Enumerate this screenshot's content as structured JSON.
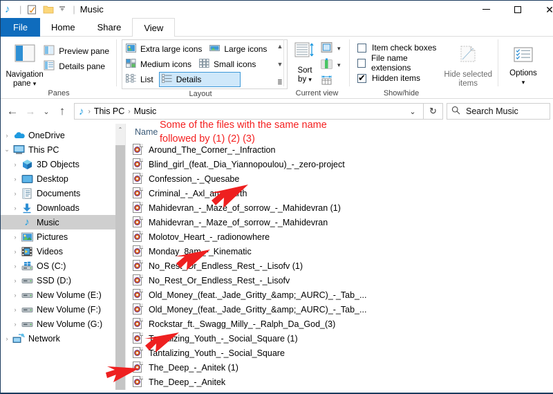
{
  "titlebar": {
    "qat_icons": [
      "music-note-icon",
      "properties-icon",
      "new-folder-icon",
      "customize-quick-access-chevron-icon"
    ],
    "title": "Music",
    "minimize_label": "—",
    "maximize_label": "□",
    "close_label": "✕"
  },
  "tabs": [
    {
      "label": "File",
      "active": false,
      "style": "file"
    },
    {
      "label": "Home",
      "active": false
    },
    {
      "label": "Share",
      "active": false
    },
    {
      "label": "View",
      "active": true
    }
  ],
  "ribbon": {
    "panes": {
      "group_label": "Panes",
      "navigation_pane": "Navigation\npane",
      "navigation_pane_line1": "Navigation",
      "navigation_pane_line2": "pane",
      "preview_pane": "Preview pane",
      "details_pane": "Details pane"
    },
    "layout": {
      "group_label": "Layout",
      "items": [
        {
          "label": "Extra large icons",
          "selected": false
        },
        {
          "label": "Large icons",
          "selected": false
        },
        {
          "label": "Medium icons",
          "selected": false
        },
        {
          "label": "Small icons",
          "selected": false
        },
        {
          "label": "List",
          "selected": false
        },
        {
          "label": "Details",
          "selected": true
        }
      ],
      "scroll_up": "▲",
      "scroll_down": "▼",
      "expand": "≣"
    },
    "current_view": {
      "group_label": "Current view",
      "sort_by_line1": "Sort",
      "sort_by_line2": "by",
      "group_by_icon": "group-by-icon",
      "add_columns_icon": "add-columns-icon",
      "size_columns_icon": "size-all-columns-to-fit-icon"
    },
    "show_hide": {
      "group_label": "Show/hide",
      "checkboxes": [
        {
          "label": "Item check boxes",
          "checked": false
        },
        {
          "label": "File name extensions",
          "checked": false
        },
        {
          "label": "Hidden items",
          "checked": true
        }
      ],
      "hide_selected_line1": "Hide selected",
      "hide_selected_line2": "items"
    },
    "options": {
      "label": "Options",
      "caret": "▾"
    }
  },
  "addressbar": {
    "back": "←",
    "forward": "→",
    "recent": "⌄",
    "up": "↑",
    "path_icon": "music-note-icon",
    "crumbs": [
      "This PC",
      "Music"
    ],
    "separator": "›",
    "dropdown": "⌄",
    "refresh": "↻",
    "search_placeholder": "Search Music"
  },
  "navpane": {
    "items": [
      {
        "label": "OneDrive",
        "icon": "onedrive-cloud-icon",
        "indent": 0,
        "chevron": "›",
        "selected": false
      },
      {
        "label": "This PC",
        "icon": "this-pc-monitor-icon",
        "indent": 0,
        "chevron": "⌄",
        "selected": false
      },
      {
        "label": "3D Objects",
        "icon": "3d-objects-icon",
        "indent": 1,
        "chevron": "›",
        "selected": false
      },
      {
        "label": "Desktop",
        "icon": "desktop-icon",
        "indent": 1,
        "chevron": "›",
        "selected": false
      },
      {
        "label": "Documents",
        "icon": "documents-icon",
        "indent": 1,
        "chevron": "›",
        "selected": false
      },
      {
        "label": "Downloads",
        "icon": "downloads-arrow-icon",
        "indent": 1,
        "chevron": "›",
        "selected": false
      },
      {
        "label": "Music",
        "icon": "music-note-icon",
        "indent": 1,
        "chevron": "",
        "selected": true
      },
      {
        "label": "Pictures",
        "icon": "pictures-icon",
        "indent": 1,
        "chevron": "›",
        "selected": false
      },
      {
        "label": "Videos",
        "icon": "videos-icon",
        "indent": 1,
        "chevron": "›",
        "selected": false
      },
      {
        "label": "OS (C:)",
        "icon": "windows-drive-icon",
        "indent": 1,
        "chevron": "›",
        "selected": false
      },
      {
        "label": "SSD (D:)",
        "icon": "drive-icon",
        "indent": 1,
        "chevron": "›",
        "selected": false
      },
      {
        "label": "New Volume (E:)",
        "icon": "drive-icon",
        "indent": 1,
        "chevron": "›",
        "selected": false
      },
      {
        "label": "New Volume (F:)",
        "icon": "drive-icon",
        "indent": 1,
        "chevron": "›",
        "selected": false
      },
      {
        "label": "New Volume (G:)",
        "icon": "drive-icon",
        "indent": 1,
        "chevron": "›",
        "selected": false
      },
      {
        "label": "Network",
        "icon": "network-icon",
        "indent": 0,
        "chevron": "›",
        "selected": false
      }
    ],
    "scroll_up": "⌃"
  },
  "filelist": {
    "column_header": "Name",
    "rows": [
      {
        "name": "Around_The_Corner_-_Infraction"
      },
      {
        "name": "Blind_girl_(feat._Dia_Yiannopoulou)_-_zero-project"
      },
      {
        "name": "Confession_-_Quesabe"
      },
      {
        "name": "Criminal_-_Axl_amp_Arth"
      },
      {
        "name": "Mahidevran_-_Maze_of_sorrow_-_Mahidevran (1)"
      },
      {
        "name": "Mahidevran_-_Maze_of_sorrow_-_Mahidevran"
      },
      {
        "name": "Molotov_Heart_-_radionowhere"
      },
      {
        "name": "Monday_8am_-_Kinematic"
      },
      {
        "name": "No_Rest_Or_Endless_Rest_-_Lisofv (1)"
      },
      {
        "name": "No_Rest_Or_Endless_Rest_-_Lisofv"
      },
      {
        "name": "Old_Money_(feat._Jade_Gritty_&amp;_AURC)_-_Tab_..."
      },
      {
        "name": "Old_Money_(feat._Jade_Gritty_&amp;_AURC)_-_Tab_..."
      },
      {
        "name": "Rockstar_ft._Swagg_Milly_-_Ralph_Da_God_(3)"
      },
      {
        "name": "Tantalizing_Youth_-_Social_Square (1)"
      },
      {
        "name": "Tantalizing_Youth_-_Social_Square"
      },
      {
        "name": "The_Deep_-_Anitek (1)"
      },
      {
        "name": "The_Deep_-_Anitek"
      }
    ]
  },
  "annotation": {
    "color": "#f41f1f",
    "line1": "Some of the files with the same name",
    "line2": "followed by (1) (2) (3)",
    "arrows": 4
  }
}
